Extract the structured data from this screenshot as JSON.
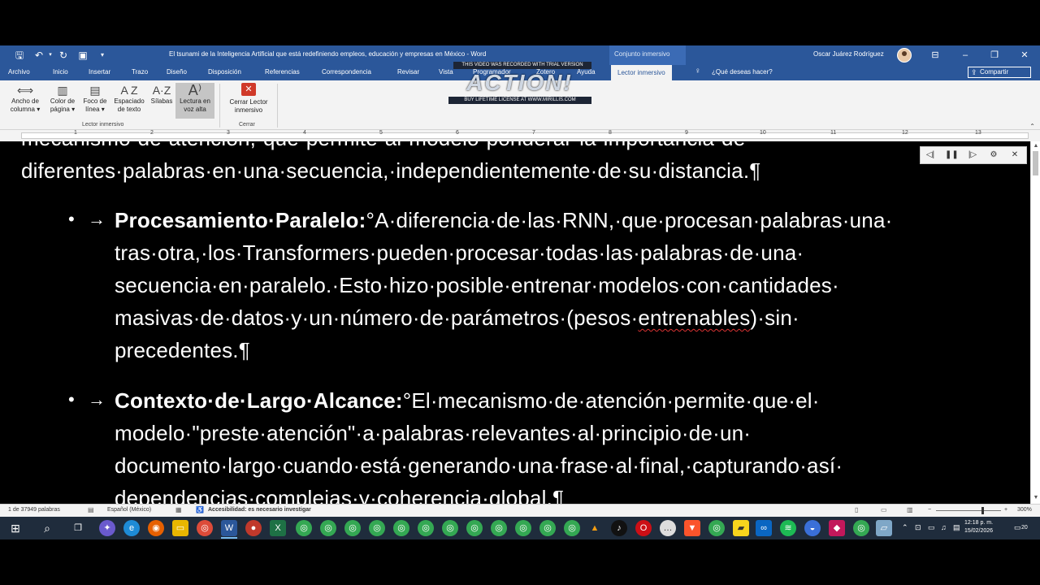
{
  "window": {
    "doc_title": "El tsunami de la Inteligencia Artificial que está redefiniendo empleos, educación y empresas en México  -  Word",
    "context_tab_group": "Conjunto inmersivo",
    "user_name": "Oscar Juárez Rodríguez"
  },
  "ribbon_tabs": [
    "Archivo",
    "Inicio",
    "Insertar",
    "Trazo",
    "Diseño",
    "Disposición",
    "Referencias",
    "Correspondencia",
    "Revisar",
    "Vista",
    "Programador",
    "Zotero",
    "Ayuda"
  ],
  "active_tab": "Lector inmersivo",
  "tell_me": "¿Qué deseas hacer?",
  "share_label": "Compartir",
  "watermark": {
    "top": "THIS VIDEO WAS RECORDED WITH TRIAL VERSION",
    "logo": "ACTION!",
    "bottom": "BUY LIFETIME LICENSE AT WWW.MIRILLIS.COM"
  },
  "ribbon": {
    "buttons": [
      {
        "line1": "Ancho de",
        "line2": "columna ▾"
      },
      {
        "line1": "Color de",
        "line2": "página ▾"
      },
      {
        "line1": "Foco de",
        "line2": "línea ▾"
      },
      {
        "line1": "Espaciado",
        "line2": "de texto"
      },
      {
        "line1": "Sílabas",
        "line2": ""
      },
      {
        "line1": "Lectura en",
        "line2": "voz alta"
      }
    ],
    "group1_label": "Lector inmersivo",
    "close_line1": "Cerrar Lector",
    "close_line2": "inmersivo",
    "group2_label": "Cerrar"
  },
  "ruler_numbers": [
    "1",
    "2",
    "3",
    "4",
    "5",
    "6",
    "7",
    "8",
    "9",
    "10",
    "11",
    "12",
    "13"
  ],
  "document": {
    "line_partial_top": "mecanismo·de·atención,·que·permite·al·modelo·ponderar·la·importancia·de·",
    "line_first": "diferentes·palabras·en·una·secuencia,·independientemente·de·su·distancia.¶",
    "bullet": "•",
    "arrow": "→",
    "item1_title": "Procesamiento·Paralelo:",
    "item1_first": "°A·diferencia·de·las·RNN,·que·procesan·palabras·una·",
    "item1_l2": "tras·otra,·los·Transformers·pueden·procesar·todas·las·palabras·de·una·",
    "item1_l3": "secuencia·en·paralelo.·Esto·hizo·posible·entrenar·modelos·con·cantidades·",
    "item1_l4a": "masivas·de·datos·y·un·número·de·parámetros·(pesos·",
    "item1_l4_squiggle": "entrenables",
    "item1_l4b": ")·sin·",
    "item1_l5": "precedentes.¶",
    "item2_title": "Contexto·de·Largo·Alcance:",
    "item2_first": "°El·mecanismo·de·atención·permite·que·el·",
    "item2_l2": "modelo·\"preste·atención\"·a·palabras·relevantes·al·principio·de·un·",
    "item2_l3": "documento·largo·cuando·está·generando·una·frase·al·final,·capturando·así·",
    "item2_l4": "dependencias·complejas·y·coherencia·global.¶"
  },
  "status": {
    "words": "1 de 37949 palabras",
    "language": "Español (México)",
    "accessibility": "Accesibilidad: es necesario investigar",
    "zoom": "300%",
    "zoom_minus": "−",
    "zoom_plus": "+"
  },
  "taskbar": {
    "time": "12:18 p. m.",
    "date": "15/02/2026",
    "notifications": "20"
  },
  "colors": {
    "word_blue": "#2b579a",
    "doc_bg": "#000000",
    "doc_text": "#ffffff"
  }
}
